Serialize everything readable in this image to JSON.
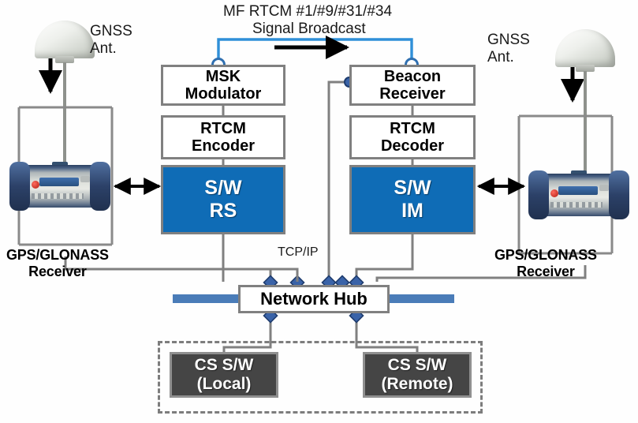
{
  "diagram": {
    "title_line1": "MF RTCM #1/#9/#31/#34",
    "title_line2": "Signal Broadcast",
    "tcpip_label": "TCP/IP",
    "colors": {
      "software_block": "#0f6cb6",
      "broadcast_link": "#2f8fd8",
      "hub_bar": "#4a7cb8",
      "node_dot": "#3a63a8",
      "box_border": "#808080",
      "dark_box": "#454545"
    }
  },
  "left_station": {
    "antenna_label_line1": "GNSS",
    "antenna_label_line2": "Ant.",
    "antenna_icon": "gnss-dome-antenna-icon",
    "receiver_icon": "gnss-receiver-device-icon",
    "receiver_label_line1": "GPS/GLONASS",
    "receiver_label_line2": "Receiver"
  },
  "right_station": {
    "antenna_label_line1": "GNSS",
    "antenna_label_line2": "Ant.",
    "antenna_icon": "gnss-dome-antenna-icon",
    "receiver_icon": "gnss-receiver-device-icon",
    "receiver_label_line1": "GPS/GLONASS",
    "receiver_label_line2": "Receiver"
  },
  "reference_station_stack": {
    "modulator_line1": "MSK",
    "modulator_line2": "Modulator",
    "encoder_line1": "RTCM",
    "encoder_line2": "Encoder",
    "software_line1": "S/W",
    "software_line2": "RS"
  },
  "integrity_monitor_stack": {
    "receiver_line1": "Beacon",
    "receiver_line2": "Receiver",
    "decoder_line1": "RTCM",
    "decoder_line2": "Decoder",
    "software_line1": "S/W",
    "software_line2": "IM"
  },
  "network": {
    "hub_label": "Network Hub"
  },
  "control_station": {
    "local_line1": "CS S/W",
    "local_line2": "(Local)",
    "remote_line1": "CS S/W",
    "remote_line2": "(Remote)"
  }
}
